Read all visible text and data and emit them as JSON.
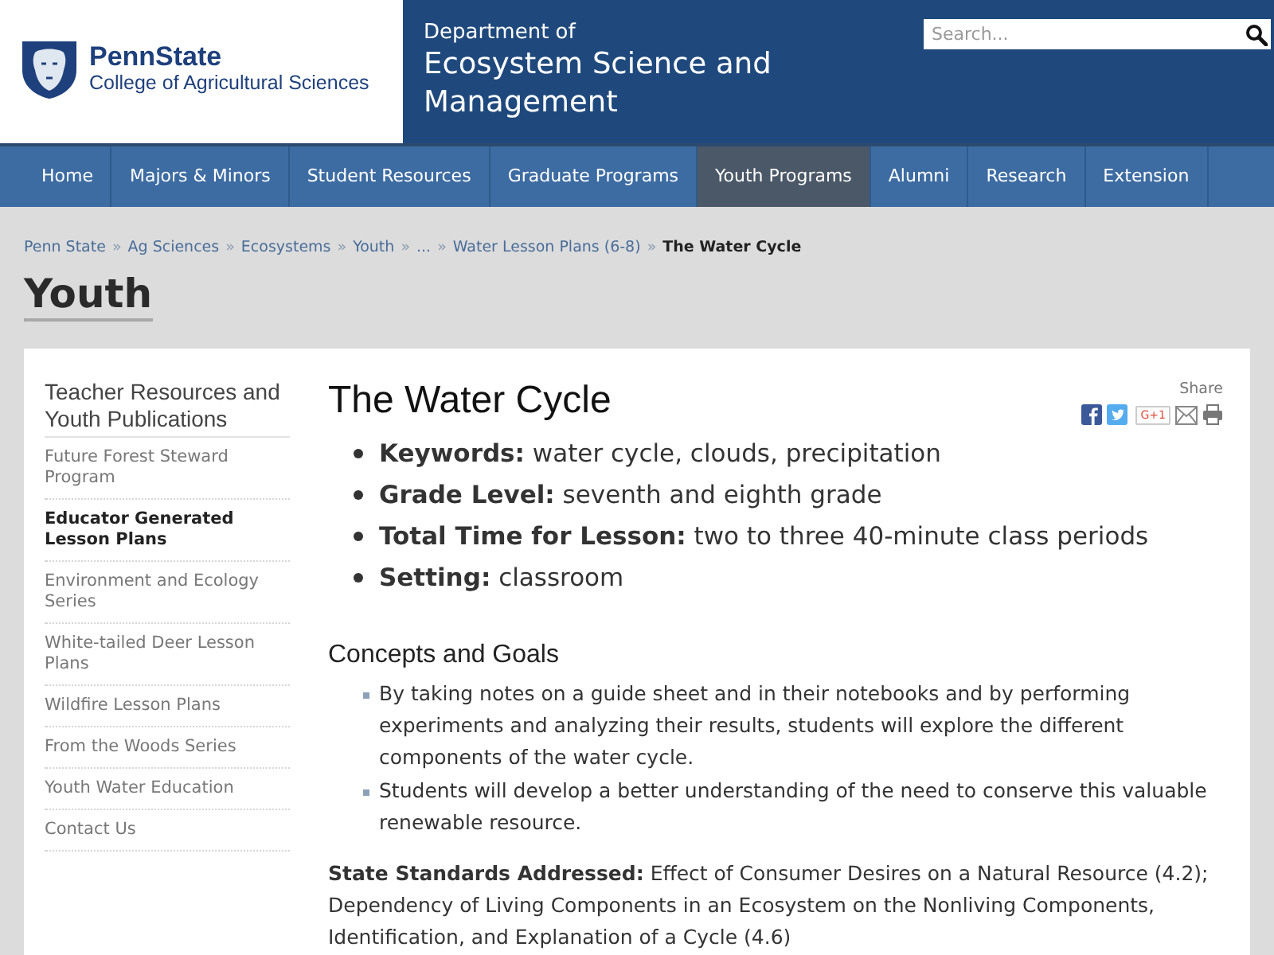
{
  "header": {
    "logo": {
      "wordmark": "PennState",
      "subtitle": "College of Agricultural Sciences"
    },
    "department": {
      "prefix": "Department of",
      "name": "Ecosystem Science and Management"
    },
    "search": {
      "placeholder": "Search..."
    }
  },
  "nav": [
    {
      "label": "Home",
      "selected": false
    },
    {
      "label": "Majors & Minors",
      "selected": false
    },
    {
      "label": "Student Resources",
      "selected": false
    },
    {
      "label": "Graduate Programs",
      "selected": false
    },
    {
      "label": "Youth Programs",
      "selected": true
    },
    {
      "label": "Alumni",
      "selected": false
    },
    {
      "label": "Research",
      "selected": false
    },
    {
      "label": "Extension",
      "selected": false
    }
  ],
  "breadcrumb": [
    {
      "kind": "link",
      "text": "Penn State"
    },
    {
      "kind": "separator",
      "text": "»"
    },
    {
      "kind": "link",
      "text": "Ag Sciences"
    },
    {
      "kind": "separator",
      "text": "»"
    },
    {
      "kind": "link",
      "text": "Ecosystems"
    },
    {
      "kind": "separator",
      "text": "»"
    },
    {
      "kind": "link",
      "text": "Youth"
    },
    {
      "kind": "separator",
      "text": "»"
    },
    {
      "kind": "link",
      "text": "..."
    },
    {
      "kind": "separator",
      "text": "»"
    },
    {
      "kind": "link",
      "text": "Water Lesson Plans (6-8)"
    },
    {
      "kind": "separator",
      "text": "»"
    },
    {
      "kind": "current",
      "text": "The Water Cycle"
    }
  ],
  "section_title": "Youth",
  "sidebar": {
    "heading": "Teacher Resources and Youth Publications",
    "items": [
      {
        "label": "Future Forest Steward Program",
        "selected": false
      },
      {
        "label": "Educator Generated Lesson Plans",
        "selected": true
      },
      {
        "label": "Environment and Ecology Series",
        "selected": false
      },
      {
        "label": "White-tailed Deer Lesson Plans",
        "selected": false
      },
      {
        "label": "Wildfire Lesson Plans",
        "selected": false
      },
      {
        "label": "From the Woods Series",
        "selected": false
      },
      {
        "label": "Youth Water Education",
        "selected": false
      },
      {
        "label": "Contact Us",
        "selected": false
      }
    ]
  },
  "article": {
    "title": "The Water Cycle",
    "share": {
      "label": "Share",
      "google_plus": "G+1"
    },
    "facts": [
      "**Keywords:** water cycle, clouds, precipitation",
      "**Grade Level:** seventh and eighth grade",
      "**Total Time for Lesson:** two to three 40-minute class periods",
      "**Setting:** classroom"
    ],
    "concepts": {
      "heading": "Concepts and Goals",
      "items": [
        "By taking notes on a guide sheet and in their notebooks and by performing experiments and analyzing their results, students will explore the different components of the water cycle.",
        "Students will develop a better understanding of the need to conserve this valuable renewable resource."
      ]
    },
    "standards": "**State Standards Addressed:** Effect of Consumer Desires on a Natural Resource (4.2); Dependency of Living Components in an Ecosystem on the Nonliving Components, Identification, and Explanation of a Cycle (4.6)"
  }
}
